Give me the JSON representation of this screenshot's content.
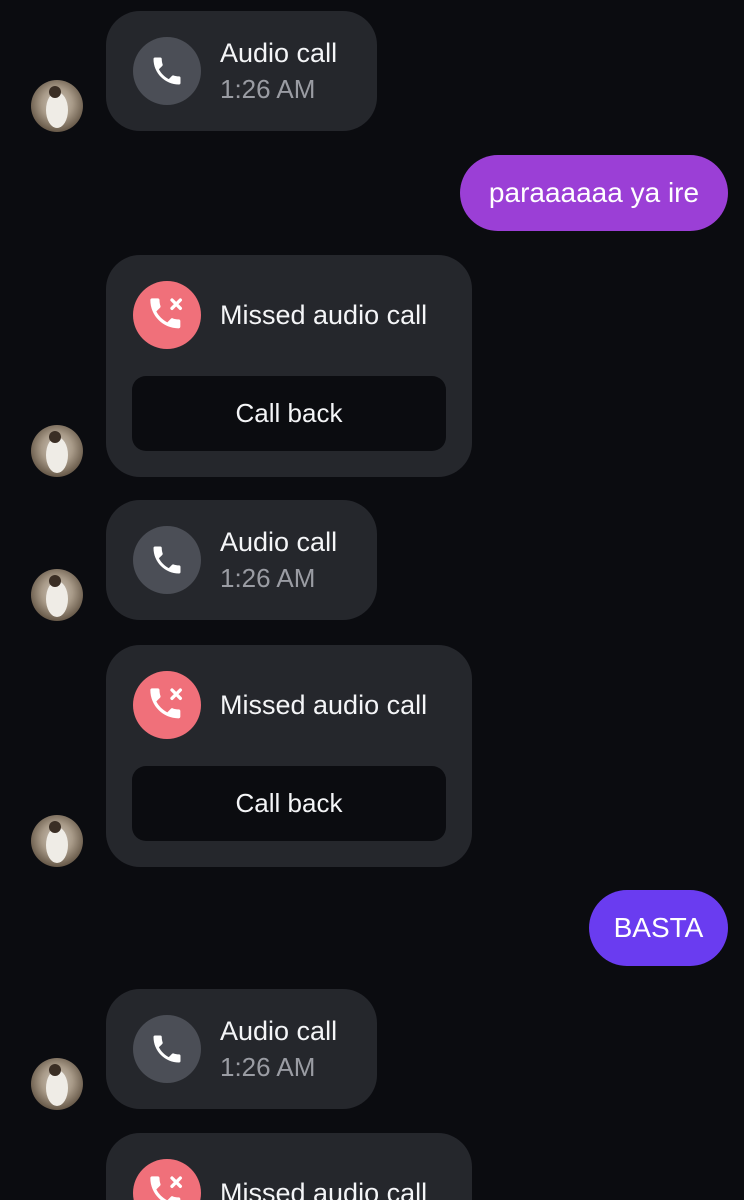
{
  "messages": [
    {
      "kind": "call",
      "title": "Audio call",
      "time": "1:26 AM"
    },
    {
      "kind": "sent",
      "text": "paraaaaaa ya ire",
      "color": "#9b3fd6"
    },
    {
      "kind": "missed",
      "title": "Missed audio call",
      "action": "Call back"
    },
    {
      "kind": "call",
      "title": "Audio call",
      "time": "1:26 AM"
    },
    {
      "kind": "missed",
      "title": "Missed audio call",
      "action": "Call back"
    },
    {
      "kind": "sent",
      "text": "BASTA",
      "color": "#6a3cf0"
    },
    {
      "kind": "call",
      "title": "Audio call",
      "time": "1:26 AM"
    },
    {
      "kind": "missed",
      "title": "Missed audio call"
    }
  ],
  "colors": {
    "background": "#0b0c10",
    "card": "#25272c",
    "call_icon_bg": "#4b4e56",
    "missed_icon_bg": "#f0707a",
    "sent_bubble_1": "#9b3fd6",
    "sent_bubble_2": "#6a3cf0"
  },
  "icons": {
    "call": "phone-icon",
    "missed": "missed-call-icon",
    "avatar": "contact-avatar"
  }
}
